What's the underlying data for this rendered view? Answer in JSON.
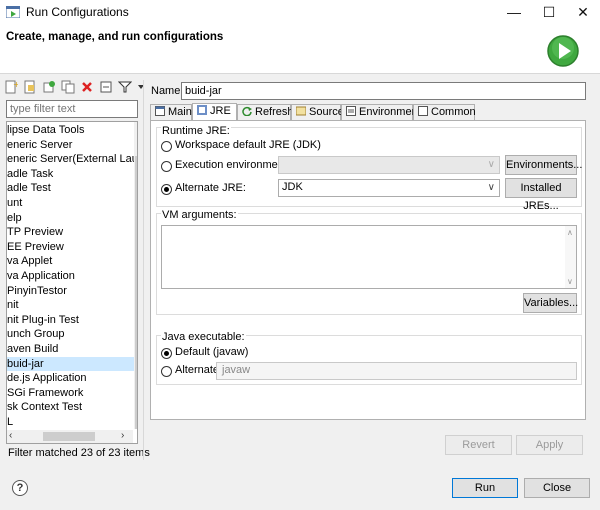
{
  "window": {
    "title": "Run Configurations",
    "minimize_glyph": "—",
    "maximize_glyph": "☐",
    "close_glyph": "✕"
  },
  "header": {
    "text": "Create, manage, and run configurations",
    "run_icon": "run-icon",
    "accent": "#3fa83f"
  },
  "left": {
    "toolbar_icons": [
      "new-config-icon",
      "new-prototype-icon",
      "export-icon",
      "duplicate-icon",
      "delete-icon",
      "collapse-all-icon",
      "filter-icon",
      "dropdown-icon"
    ],
    "filter": {
      "placeholder": "type filter text",
      "value": ""
    },
    "tree_items": [
      "lipse Data Tools",
      "eneric Server",
      "eneric Server(External Launch",
      "adle Task",
      "adle Test",
      "unt",
      "elp",
      "TP Preview",
      "EE Preview",
      "va Applet",
      "va Application",
      "PinyinTestor",
      "nit",
      "nit Plug-in Test",
      "unch Group",
      "aven Build",
      "buid-jar",
      "de.js Application",
      "SGi Framework",
      "sk Context Test",
      "L"
    ],
    "selected_item": "buid-jar",
    "status": "Filter matched 23 of 23 items"
  },
  "config": {
    "name_label": "Name:",
    "name_value": "buid-jar",
    "tabs": [
      {
        "label": "Main",
        "icon": "main-tab-icon"
      },
      {
        "label": "JRE",
        "icon": "jre-tab-icon"
      },
      {
        "label": "Refresh",
        "icon": "refresh-tab-icon"
      },
      {
        "label": "Source",
        "icon": "source-tab-icon"
      },
      {
        "label": "Environment",
        "icon": "environment-tab-icon"
      },
      {
        "label": "Common",
        "icon": "common-tab-icon"
      }
    ],
    "active_tab": "JRE",
    "runtime_jre": {
      "group_label": "Runtime JRE:",
      "workspace_default": "Workspace default JRE (JDK)",
      "execution_env": "Execution environment:",
      "environments_button": "Environments...",
      "alternate_jre": "Alternate JRE:",
      "alternate_value": "JDK",
      "installed_button": "Installed JREs...",
      "selected": "alternate"
    },
    "vm_args": {
      "label": "VM arguments:",
      "value": "",
      "variables_button": "Variables..."
    },
    "java_exec": {
      "group_label": "Java executable:",
      "default_option": "Default (javaw)",
      "alternate_option": "Alternate",
      "alternate_value": "javaw",
      "selected": "default"
    },
    "revert_button": "Revert",
    "apply_button": "Apply"
  },
  "footer": {
    "help_glyph": "?",
    "run_button": "Run",
    "close_button": "Close"
  }
}
